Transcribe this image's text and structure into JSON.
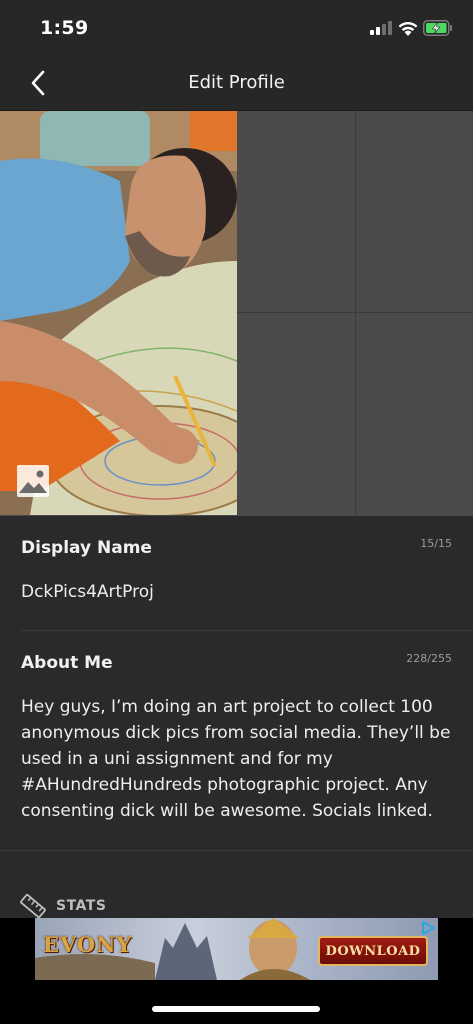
{
  "status_bar": {
    "time": "1:59"
  },
  "nav": {
    "title": "Edit Profile"
  },
  "display_name": {
    "label": "Display Name",
    "count": "15/15",
    "value": "DckPics4ArtProj"
  },
  "about_me": {
    "label": "About Me",
    "count": "228/255",
    "value": "Hey guys, I’m doing an art project to collect 100 anonymous dick pics from social media. They’ll be used in a uni assignment and for my #AHundredHundreds photographic project. Any consenting dick will be awesome. Socials linked."
  },
  "stats": {
    "label": "STATS"
  },
  "ad": {
    "brand": "EVONY",
    "cta": "DOWNLOAD"
  },
  "colors": {
    "background": "#2a2a2c",
    "bar": "#272727",
    "divider": "#3c3c3e",
    "ad_button": "#8e1a10"
  }
}
